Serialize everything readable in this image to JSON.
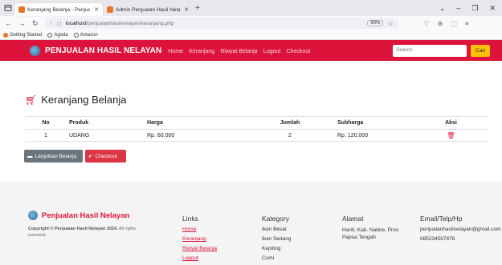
{
  "browser": {
    "tabs": [
      {
        "title": "Keranjang Belanja - Penjualan H",
        "active": true
      },
      {
        "title": "Admin Penjualan Hasil Nelayan",
        "active": false
      }
    ],
    "url_path_host": "localhost",
    "url_path_rest": "/penjualanhasilnelayan/keranjang.php",
    "zoom": "90%",
    "bookmarks": [
      "Getting Started",
      "Agoda",
      "Amazon"
    ]
  },
  "site": {
    "brand": "PENJUALAN HASIL NELAYAN",
    "menu": [
      "Home",
      "Keranjang",
      "Riwyat Belanja",
      "Logout",
      "Checkout"
    ],
    "search_placeholder": "Search",
    "search_button": "Cari"
  },
  "cart": {
    "title": "Keranjang Belanja",
    "headers": [
      "No",
      "Produk",
      "Harga",
      "Jumlah",
      "Subharga",
      "Aksi"
    ],
    "rows": [
      {
        "no": "1",
        "produk": "UDANG",
        "harga": "Rp. 60,000",
        "jumlah": "2",
        "subharga": "Rp. 120,000"
      }
    ],
    "btn_continue": "Lanjutkan Belanja",
    "btn_checkout": "Checkout"
  },
  "footer": {
    "brand": "Penjualan Hasil Nelayan",
    "copyright_bold": "Copyright © Penjualan Hasil Nelayan 2024.",
    "copyright_rest": " All rights reserved.",
    "links_title": "Links",
    "links": [
      "Home",
      "Keranjang",
      "Riwyat Belanja",
      "Logout"
    ],
    "category_title": "Kategory",
    "categories": [
      "Ikan Besar",
      "Ikan Sedang",
      "Kepiting",
      "Cumi"
    ],
    "address_title": "Alamat",
    "address": "Hariti, Kab. Nabire, Prov. Papua Tengah",
    "contact_title": "Email/Telp/Hp",
    "email": "penjualanhasilnelayan@gmail.com",
    "phone": "085234567876"
  }
}
